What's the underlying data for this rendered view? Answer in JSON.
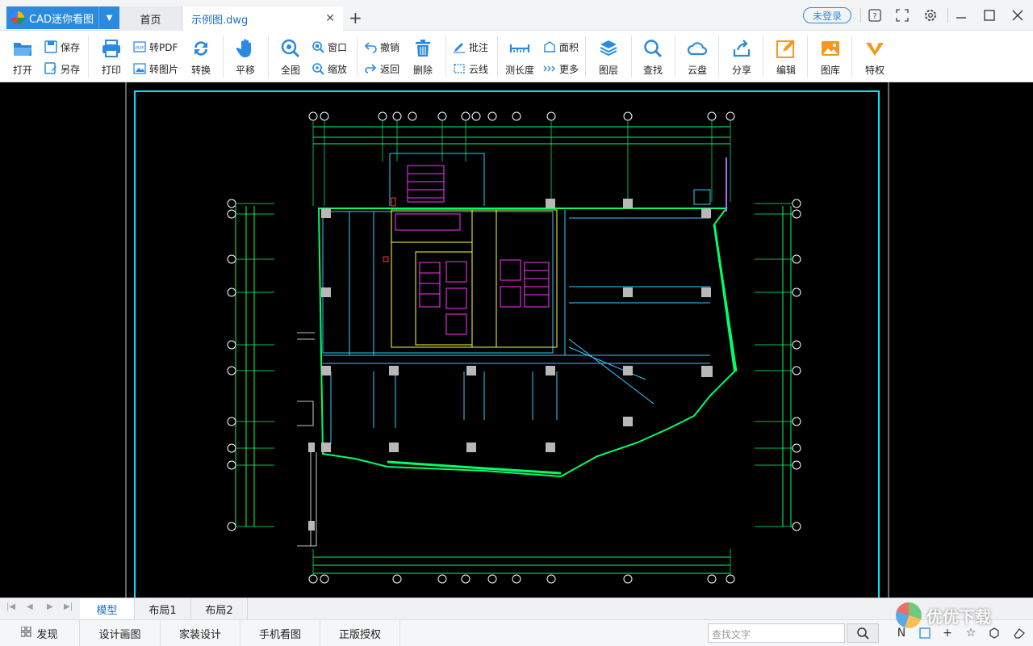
{
  "app": {
    "name": "CAD迷你看图"
  },
  "tabs": {
    "home": "首页",
    "file": "示例图.dwg"
  },
  "header": {
    "login_label": "未登录"
  },
  "ribbon": {
    "open": "打开",
    "save": "保存",
    "save_as": "另存",
    "print": "打印",
    "to_pdf": "转PDF",
    "to_image": "转图片",
    "convert": "转换",
    "pan": "平移",
    "full_view": "全图",
    "window": "窗口",
    "zoom": "缩放",
    "undo": "撤销",
    "back": "返回",
    "delete": "删除",
    "annotate": "批注",
    "cloud_line": "云线",
    "measure_length": "测长度",
    "area": "面积",
    "more": "更多",
    "layer": "图层",
    "find": "查找",
    "cloud_disk": "云盘",
    "share": "分享",
    "edit": "编辑",
    "library": "图库",
    "privilege": "特权"
  },
  "layout_tabs": [
    "模型",
    "布局1",
    "布局2"
  ],
  "status_bar": {
    "discover": "发现",
    "design_drawing": "设计画图",
    "home_design": "家装设计",
    "mobile_view": "手机看图",
    "genuine_license": "正版授权",
    "search_placeholder": "查找文字"
  },
  "colors": {
    "accent": "#2a8ae0",
    "canvas_bg": "#000000",
    "frame": "#00e5ff"
  },
  "watermark": "优优下载"
}
